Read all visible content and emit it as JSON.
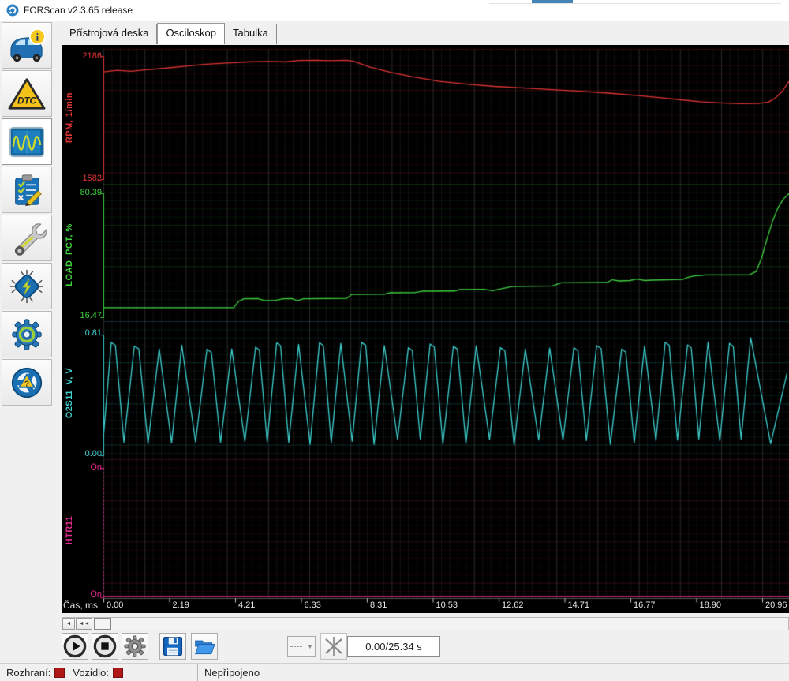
{
  "window": {
    "title": "FORScan v2.3.65 release"
  },
  "tabs": {
    "items": [
      {
        "label": "Přístrojová deska",
        "active": false
      },
      {
        "label": "Osciloskop",
        "active": true
      },
      {
        "label": "Tabulka",
        "active": false
      }
    ]
  },
  "sidebar": {
    "items": [
      {
        "icon": "vehicle-info"
      },
      {
        "icon": "dtc",
        "badge": "DTC"
      },
      {
        "icon": "oscilloscope",
        "active": true
      },
      {
        "icon": "tests"
      },
      {
        "icon": "service"
      },
      {
        "icon": "configuration-chip"
      },
      {
        "icon": "settings-gear"
      },
      {
        "icon": "help"
      }
    ]
  },
  "chart_data": {
    "type": "line",
    "title": "Osciloskop",
    "background": "#000000",
    "grid": true,
    "x_axis": {
      "label": "Čas, ms",
      "ticks": [
        "0.00",
        "2.19",
        "4.21",
        "6.33",
        "8.31",
        "10.53",
        "12.62",
        "14.71",
        "16.77",
        "18.90",
        "20.96"
      ]
    },
    "series": [
      {
        "name": "RPM, 1/min",
        "color": "#e03434",
        "y_max": "2186",
        "y_min": "1582",
        "points": [
          [
            0,
            2108
          ],
          [
            0.02,
            2116
          ],
          [
            0.04,
            2111
          ],
          [
            0.06,
            2118
          ],
          [
            0.09,
            2126
          ],
          [
            0.12,
            2136
          ],
          [
            0.15,
            2146
          ],
          [
            0.18,
            2152
          ],
          [
            0.21,
            2157
          ],
          [
            0.24,
            2159
          ],
          [
            0.265,
            2157
          ],
          [
            0.285,
            2164
          ],
          [
            0.31,
            2165
          ],
          [
            0.33,
            2163
          ],
          [
            0.355,
            2165
          ],
          [
            0.365,
            2160
          ],
          [
            0.39,
            2130
          ],
          [
            0.42,
            2105
          ],
          [
            0.45,
            2085
          ],
          [
            0.49,
            2062
          ],
          [
            0.53,
            2048
          ],
          [
            0.57,
            2037
          ],
          [
            0.61,
            2030
          ],
          [
            0.65,
            2022
          ],
          [
            0.7,
            2012
          ],
          [
            0.74,
            2003
          ],
          [
            0.78,
            1992
          ],
          [
            0.81,
            1982
          ],
          [
            0.84,
            1972
          ],
          [
            0.87,
            1962
          ],
          [
            0.9,
            1956
          ],
          [
            0.93,
            1952
          ],
          [
            0.955,
            1953
          ],
          [
            0.97,
            1960
          ],
          [
            0.98,
            1980
          ],
          [
            0.99,
            2012
          ],
          [
            1,
            2062
          ]
        ]
      },
      {
        "name": "LOAD_PCT, %",
        "color": "#3fd03f",
        "y_max": "80.39",
        "y_min": "16.47",
        "points": [
          [
            0,
            21.4
          ],
          [
            0.19,
            21.4
          ],
          [
            0.197,
            24.5
          ],
          [
            0.205,
            26.0
          ],
          [
            0.225,
            26.1
          ],
          [
            0.235,
            25.1
          ],
          [
            0.25,
            25.1
          ],
          [
            0.262,
            26.0
          ],
          [
            0.275,
            26.1
          ],
          [
            0.283,
            25.0
          ],
          [
            0.292,
            26.0
          ],
          [
            0.355,
            26.2
          ],
          [
            0.362,
            28.2
          ],
          [
            0.41,
            28.3
          ],
          [
            0.418,
            29.1
          ],
          [
            0.455,
            29.2
          ],
          [
            0.465,
            29.9
          ],
          [
            0.512,
            30.0
          ],
          [
            0.52,
            30.8
          ],
          [
            0.555,
            30.9
          ],
          [
            0.568,
            30.2
          ],
          [
            0.578,
            31.0
          ],
          [
            0.596,
            32.3
          ],
          [
            0.61,
            32.4
          ],
          [
            0.655,
            32.6
          ],
          [
            0.668,
            34.2
          ],
          [
            0.7,
            34.3
          ],
          [
            0.735,
            34.4
          ],
          [
            0.742,
            35.8
          ],
          [
            0.752,
            35.2
          ],
          [
            0.768,
            35.4
          ],
          [
            0.778,
            36.2
          ],
          [
            0.79,
            35.4
          ],
          [
            0.8,
            35.6
          ],
          [
            0.845,
            36.0
          ],
          [
            0.852,
            37.0
          ],
          [
            0.862,
            37.8
          ],
          [
            0.872,
            38.0
          ],
          [
            0.878,
            38.3
          ],
          [
            0.942,
            38.3
          ],
          [
            0.952,
            40.0
          ],
          [
            0.96,
            47.0
          ],
          [
            0.968,
            57.0
          ],
          [
            0.976,
            66.0
          ],
          [
            0.984,
            73.0
          ],
          [
            0.992,
            77.5
          ],
          [
            1,
            80.3
          ]
        ]
      },
      {
        "name": "O2S11_V, V",
        "color": "#3fd0d0",
        "y_max": "0.81",
        "y_min": "0.00",
        "oscillation": {
          "cycles": 29,
          "low": 0.07,
          "high": 0.76,
          "final_high": 0.79
        }
      },
      {
        "name": "HTR11",
        "color": "#e02a8a",
        "y_max": "On",
        "y_min": "On",
        "axis_style": "dotted",
        "points": [
          [
            0,
            0
          ],
          [
            1,
            0
          ]
        ]
      }
    ]
  },
  "transport": {
    "time_display": "0.00/25.34 s"
  },
  "statusbar": {
    "interface_label": "Rozhraní:",
    "vehicle_label": "Vozidlo:",
    "connection_status": "Nepřipojeno",
    "indicator_color": "#b01818"
  }
}
